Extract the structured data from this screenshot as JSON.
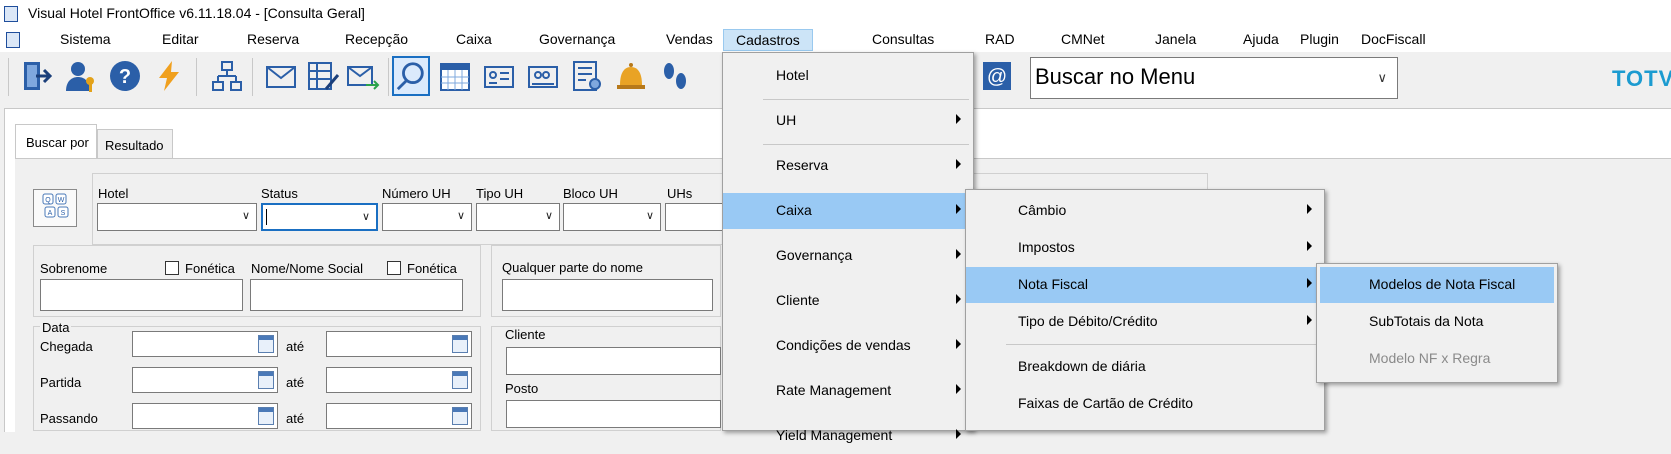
{
  "window": {
    "title": "Visual Hotel FrontOffice v6.11.18.04 - [Consulta Geral]"
  },
  "menubar": {
    "items": [
      "Sistema",
      "Editar",
      "Reserva",
      "Recepção",
      "Caixa",
      "Governança",
      "Vendas",
      "Cadastros",
      "Consultas",
      "RAD",
      "CMNet",
      "Janela",
      "Ajuda",
      "Plugin",
      "DocFiscall"
    ],
    "active": "Cadastros"
  },
  "toolbar": {
    "icons": [
      "exit-icon",
      "user-key-icon",
      "help-icon",
      "lightning-icon",
      "org-chart-icon",
      "mail-icon",
      "edit-grid-icon",
      "send-mail-icon",
      "search-icon",
      "calendar-icon",
      "card-icon",
      "card-group-icon",
      "report-icon",
      "bell-icon",
      "footprints-icon",
      "email-at-icon"
    ],
    "menu_search_value": "Buscar no Menu",
    "brand": "TOTVS",
    "colors": {
      "brand": "#1c9bd0",
      "selected_border": "#1a6fc2",
      "menu_highlight": "#99c9f4"
    }
  },
  "tabs": [
    "Buscar por",
    "Resultado"
  ],
  "form": {
    "labels": {
      "hotel": "Hotel",
      "status": "Status",
      "numero_uh": "Número UH",
      "tipo_uh": "Tipo UH",
      "bloco_uh": "Bloco UH",
      "uhs": "UHs",
      "sobrenome": "Sobrenome",
      "fonetica": "Fonética",
      "nome_social": "Nome/Nome Social",
      "qualquer_parte": "Qualquer parte do nome",
      "data": "Data",
      "chegada": "Chegada",
      "partida": "Partida",
      "passando": "Passando",
      "ate": "até",
      "cliente": "Cliente",
      "posto": "Posto"
    },
    "keyboard_button": "Q W A S"
  },
  "cadastros_menu": {
    "items": [
      {
        "label": "Hotel",
        "submenu": false
      },
      {
        "label": "UH",
        "submenu": true
      },
      {
        "label": "Reserva",
        "submenu": true
      },
      {
        "label": "Caixa",
        "submenu": true
      },
      {
        "label": "Governança",
        "submenu": true
      },
      {
        "label": "Cliente",
        "submenu": true
      },
      {
        "label": "Condições de vendas",
        "submenu": true
      },
      {
        "label": "Rate Management",
        "submenu": true
      },
      {
        "label": "Yield Management",
        "submenu": true
      }
    ],
    "highlighted": "Caixa"
  },
  "caixa_menu": {
    "items": [
      {
        "label": "Câmbio",
        "submenu": true
      },
      {
        "label": "Impostos",
        "submenu": true
      },
      {
        "label": "Nota Fiscal",
        "submenu": true
      },
      {
        "label": "Tipo de Débito/Crédito",
        "submenu": true
      },
      {
        "label": "Breakdown de diária",
        "submenu": false
      },
      {
        "label": "Faixas de Cartão de Crédito",
        "submenu": false
      }
    ],
    "highlighted": "Nota Fiscal"
  },
  "nota_fiscal_menu": {
    "items": [
      {
        "label": "Modelos de Nota Fiscal",
        "disabled": false
      },
      {
        "label": "SubTotais da Nota",
        "disabled": false
      },
      {
        "label": "Modelo NF x Regra",
        "disabled": true
      }
    ],
    "highlighted": "Modelos de Nota Fiscal"
  }
}
